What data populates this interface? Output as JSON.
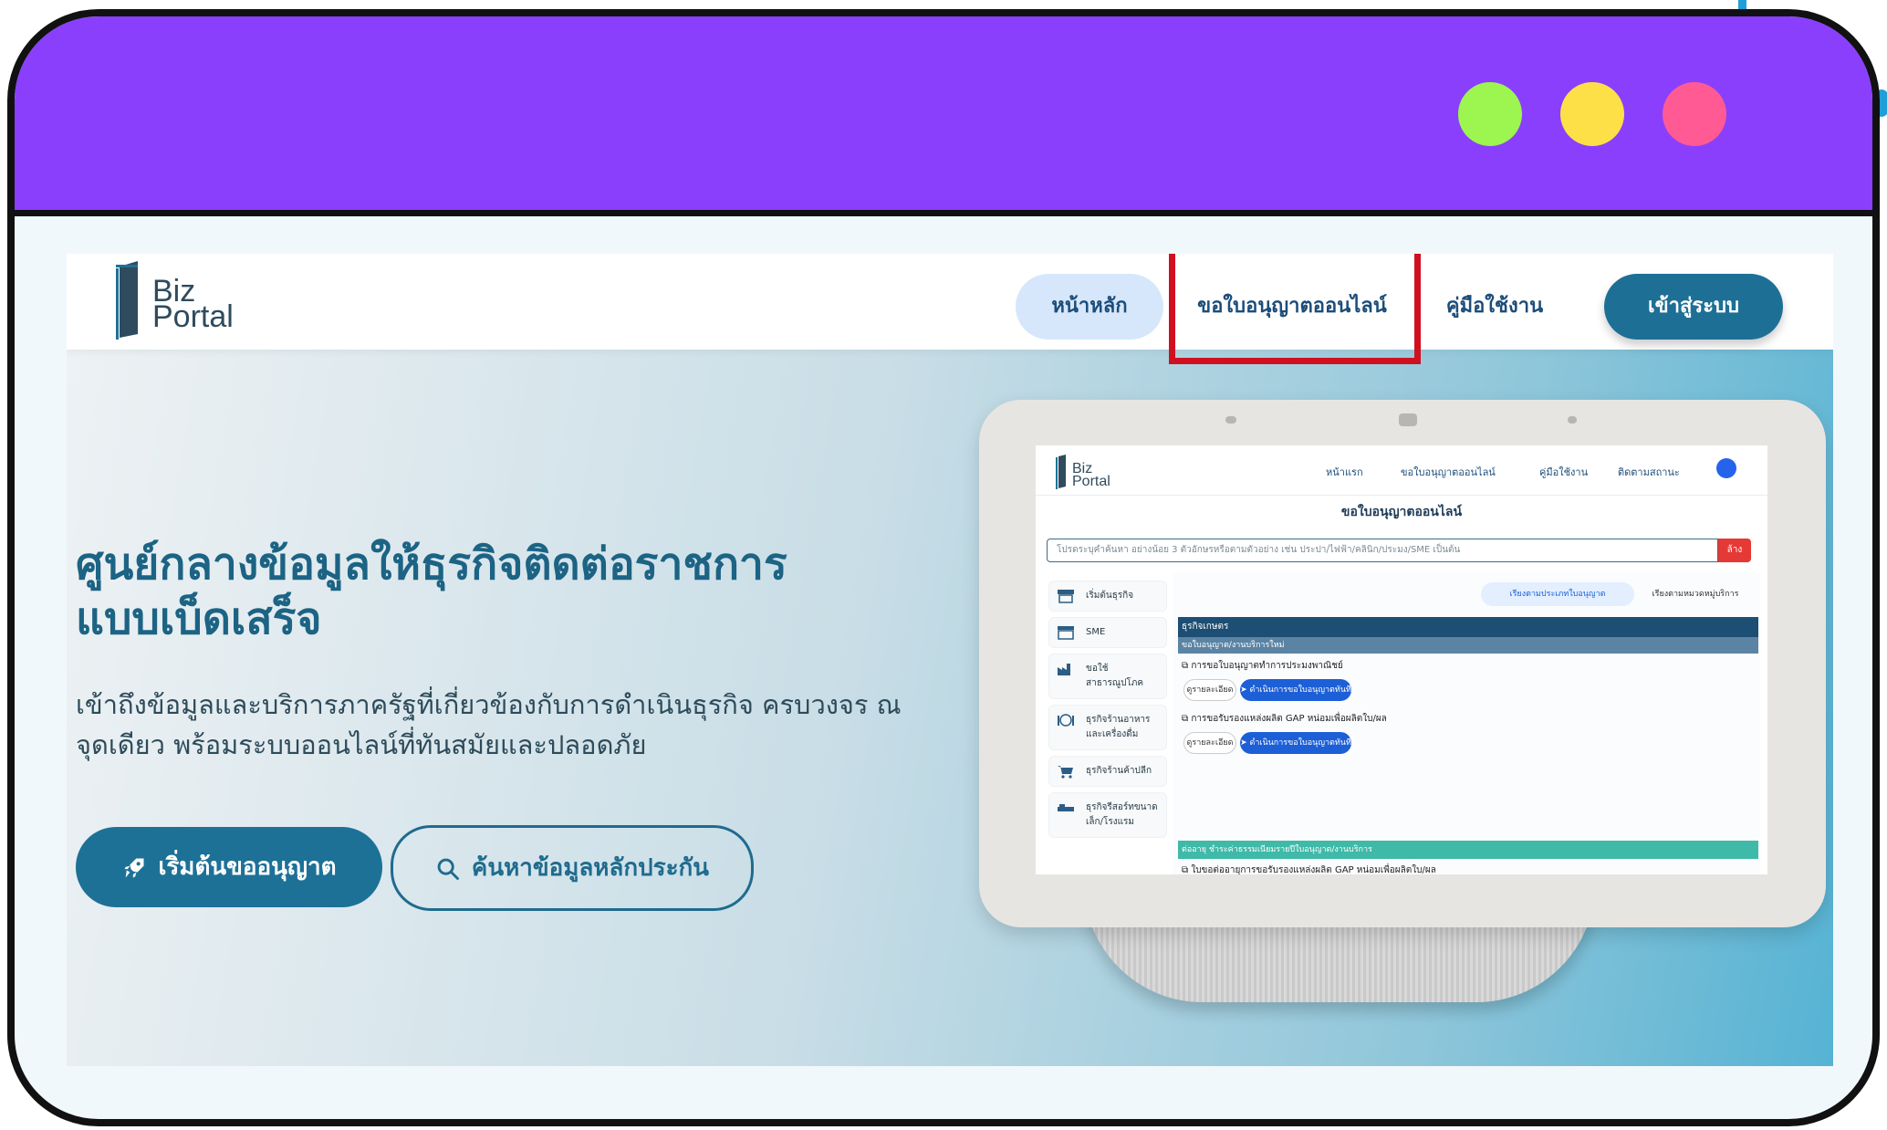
{
  "window": {
    "traffic_lights": [
      {
        "name": "green",
        "color": "#9df550"
      },
      {
        "name": "yellow",
        "color": "#fde047"
      },
      {
        "name": "red",
        "color": "#ff5a93"
      }
    ],
    "titlebar_color": "#8a3ffc"
  },
  "site": {
    "logo": {
      "line1": "Biz",
      "line2": "Portal"
    },
    "nav": {
      "home": "หน้าหลัก",
      "license_online": "ขอใบอนุญาตออนไลน์",
      "manual": "คู่มือใช้งาน",
      "login": "เข้าสู่ระบบ"
    },
    "hero": {
      "title_line1": "ศูนย์กลางข้อมูลให้ธุรกิจติดต่อราชการ",
      "title_line2": "แบบเบ็ดเสร็จ",
      "subtitle_line1": "เข้าถึงข้อมูลและบริการภาครัฐที่เกี่ยวข้องกับการดำเนินธุรกิจ ครบวงจร ณ",
      "subtitle_line2": "จุดเดียว พร้อมระบบออนไลน์ที่ทันสมัยและปลอดภัย",
      "primary_button": "เริ่มต้นขออนุญาต",
      "secondary_button": "ค้นหาข้อมูลหลักประกัน"
    },
    "colors": {
      "accent": "#1d7197",
      "highlight_box": "#d0101f",
      "nav_home_bg": "#d6e7fb"
    }
  },
  "device_screen": {
    "logo": {
      "line1": "Biz",
      "line2": "Portal"
    },
    "nav": [
      "หน้าแรก",
      "ขอใบอนุญาตออนไลน์",
      "คู่มือใช้งาน",
      "ติดตามสถานะ"
    ],
    "heading": "ขอใบอนุญาตออนไลน์",
    "search_placeholder": "โปรดระบุคำค้นหา อย่างน้อย 3 ตัวอักษรหรือตามตัวอย่าง เช่น ประปา/ไฟฟ้า/คลินิก/ประมง/SME เป็นต้น",
    "clear_button": "ล้าง",
    "sidebar": [
      {
        "label": "เริ่มต้นธุรกิจ",
        "icon": "shop-icon"
      },
      {
        "label": "SME",
        "icon": "store-icon"
      },
      {
        "label": "ขอใช้สาธารณูปโภค",
        "icon": "factory-icon"
      },
      {
        "label": "ธุรกิจร้านอาหารและเครื่องดื่ม",
        "icon": "dining-icon"
      },
      {
        "label": "ธุรกิจร้านค้าปลีก",
        "icon": "cart-icon"
      },
      {
        "label": "ธุรกิจรีสอร์ทขนาดเล็ก/โรงแรม",
        "icon": "bed-icon"
      }
    ],
    "filters": {
      "by_type": "เรียงตามประเภทใบอนุญาต",
      "by_service": "เรียงตามหมวดหมู่บริการ"
    },
    "category": "ธุรกิจเกษตร",
    "subcategory": "ขอใบอนุญาต/งานบริการใหม่",
    "items": [
      {
        "title": "การขอใบอนุญาตทำการประมงพาณิชย์",
        "detail_button": "ดูรายละเอียด",
        "action_button": "ดำเนินการขอใบอนุญาตทันที"
      },
      {
        "title": "การขอรับรองแหล่งผลิต GAP หน่อมเพื่อผลิตใบ/ผล",
        "detail_button": "ดูรายละเอียด",
        "action_button": "ดำเนินการขอใบอนุญาตทันที"
      }
    ],
    "renewal_bar": "ต่ออายุ ชำระค่าธรรมเนียมรายปีใบอนุญาต/งานบริการ",
    "renewal_item": "ใบขอต่ออายุการขอรับรองแหล่งผลิต GAP หน่อมเพื่อผลิตใบ/ผล"
  }
}
